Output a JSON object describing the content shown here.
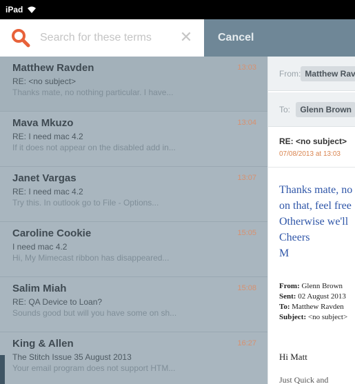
{
  "status_bar": {
    "device": "iPad"
  },
  "search": {
    "placeholder": "Search for these terms",
    "cancel_label": "Cancel"
  },
  "emails": [
    {
      "sender": "Matthew Ravden",
      "time": "13:03",
      "subject": "RE: <no subject>",
      "preview": "Thanks mate, no nothing particular. I have..."
    },
    {
      "sender": "Mava Mkuzo",
      "time": "13:04",
      "subject": "RE: I need mac 4.2",
      "preview": "If it does not appear on the disabled add in..."
    },
    {
      "sender": "Janet Vargas",
      "time": "13:07",
      "subject": "RE: I need mac 4.2",
      "preview": "Try this. In outlook go to File - Options..."
    },
    {
      "sender": "Caroline Cookie",
      "time": "15:05",
      "subject": "I need mac 4.2",
      "preview": "Hi, My Mimecast ribbon has disappeared..."
    },
    {
      "sender": "Salim Miah",
      "time": "15:08",
      "subject": "RE: QA Device to Loan?",
      "preview": "Sounds good but will you have some on sh..."
    },
    {
      "sender": "King & Allen",
      "time": "16:27",
      "subject": "The Stitch Issue 35 August 2013",
      "preview": "Your email program does not support HTM..."
    }
  ],
  "reading": {
    "from_label": "From:",
    "from_value": "Matthew Ravden",
    "to_label": "To:",
    "to_value": "Glenn Brown",
    "subject": "RE: <no subject>",
    "date": "07/08/2013 at 13:03",
    "body_lines": [
      "Thanks mate, no",
      "on that, feel free",
      "Otherwise we'll",
      "Cheers",
      "M"
    ],
    "quote": {
      "from_label": "From:",
      "from_value": "Glenn Brown",
      "sent_label": "Sent:",
      "sent_value": "02 August 2013",
      "to_label": "To:",
      "to_value": "Matthew Ravden",
      "subject_label": "Subject:",
      "subject_value": "<no subject>"
    },
    "greeting": "Hi Matt",
    "next_line": "Just Quick and"
  },
  "colors": {
    "accent": "#e8623a",
    "time": "#d8906e",
    "list_bg": "#a9b6bf",
    "cancel_bg": "#6f8797",
    "body_text": "#2f56a8"
  }
}
